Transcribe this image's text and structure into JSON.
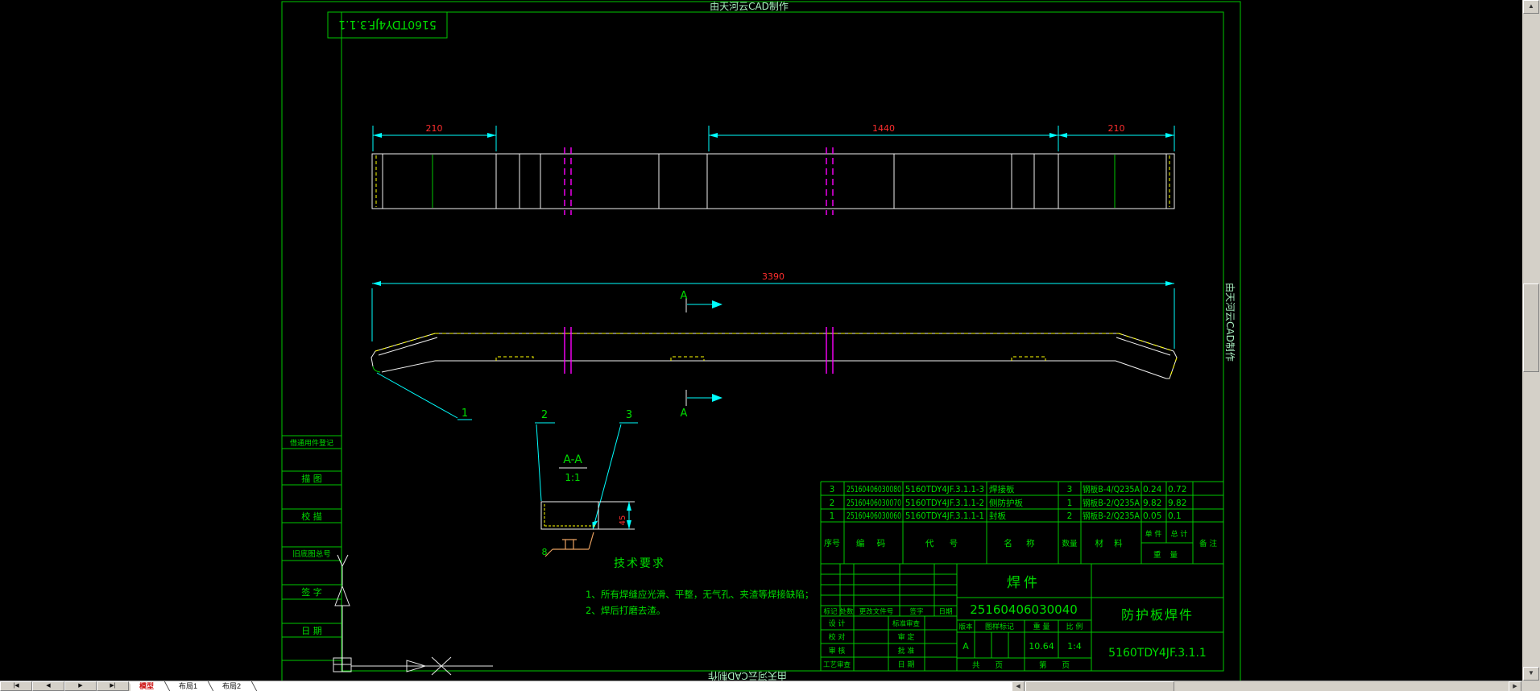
{
  "watermark": "由天河云CAD制作",
  "sheet": {
    "frame_label": "5160TDY4JF.3.1.1",
    "left_strip": [
      "借通用件登记",
      "描 图",
      "校 描",
      "旧底图总号",
      "签 字",
      "日 期"
    ]
  },
  "drawing": {
    "dims": {
      "left": "210",
      "middle": "1440",
      "right": "210",
      "total": "3390",
      "section_height": "45"
    },
    "balloons": [
      "1",
      "2",
      "3"
    ],
    "section": {
      "mark": "A",
      "title": "A-A",
      "scale": "1:1",
      "weld_size": "8"
    }
  },
  "tech_req": {
    "title": "技术要求",
    "lines": [
      "1、所有焊缝应光滑、平整，无气孔、夹渣等焊接缺陷；",
      "2、焊后打磨去渣。"
    ]
  },
  "bom": {
    "headers": {
      "seq": "序号",
      "code": "编  码",
      "drawing_no": "代  号",
      "name": "名  称",
      "qty": "数量",
      "material": "材  料",
      "unit": "单 件",
      "total": "总 计",
      "weight": "重  量",
      "remark": "备 注"
    },
    "rows": [
      [
        "3",
        "25160406030080",
        "5160TDY4JF.3.1.1-3",
        "焊接板",
        "3",
        "钢板B-4/Q235A",
        "0.24",
        "0.72"
      ],
      [
        "2",
        "25160406030070",
        "5160TDY4JF.3.1.1-2",
        "侧防护板",
        "1",
        "钢板B-2/Q235A",
        "9.82",
        "9.82"
      ],
      [
        "1",
        "25160406030060",
        "5160TDY4JF.3.1.1-1",
        "封板",
        "2",
        "钢板B-2/Q235A",
        "0.05",
        "0.1"
      ]
    ]
  },
  "title_block": {
    "product": "焊件",
    "code": "25160406030040",
    "part_name": "防护板焊件",
    "drawing_no": "5160TDY4JF.3.1.1",
    "change_header": [
      "标记",
      "处数",
      "更改文件号",
      "签字",
      "日期"
    ],
    "sign_left": [
      "设 计",
      "校 对",
      "审 核",
      "工艺审查"
    ],
    "sign_right": [
      "标准审查",
      "审 定",
      "批 准",
      "日 期"
    ],
    "meta_header": [
      "版本",
      "图样标记",
      "重 量",
      "比 例"
    ],
    "version": "A",
    "weight": "10.64",
    "scale": "1:4",
    "pages": "共  页",
    "page": "第  页"
  },
  "ui": {
    "nav": [
      "|◀",
      "◀",
      "▶",
      "▶|"
    ],
    "tabs": [
      "模型",
      "布局1",
      "布局2"
    ],
    "scroll": {
      "up": "▲",
      "down": "▼",
      "left": "◀",
      "right": "▶"
    }
  },
  "colors": {
    "cad_green": "#00c800",
    "cyan": "#00ffff",
    "dim_red": "#ff2e2e",
    "magenta": "#ff00ff",
    "yellow": "#ffff00",
    "pale_green": "#a9f0c0",
    "weld_orange": "#e8a060",
    "chrome_gray": "#d4d0c8",
    "active_tab_red": "#cc1111"
  }
}
